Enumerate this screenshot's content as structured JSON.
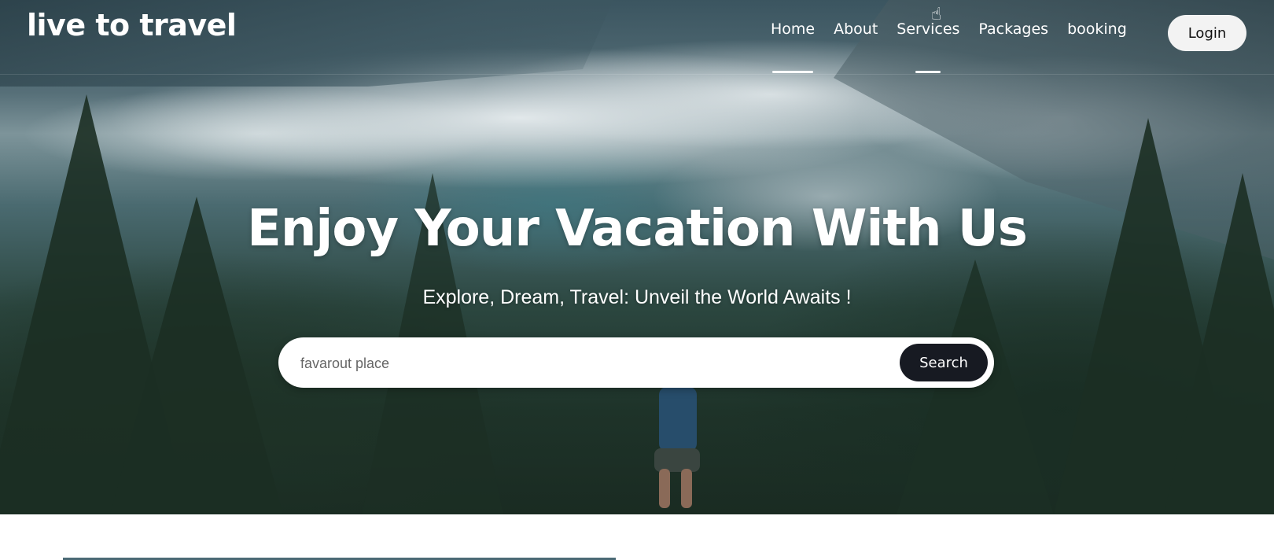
{
  "brand": {
    "logo_text": "live to travel"
  },
  "nav": {
    "items": [
      {
        "label": "Home"
      },
      {
        "label": "About"
      },
      {
        "label": "Services"
      },
      {
        "label": "Packages"
      },
      {
        "label": "booking"
      }
    ],
    "active_item": "Home",
    "hovered_item": "Services",
    "login_label": "Login"
  },
  "hero": {
    "headline": "Enjoy Your Vacation With Us",
    "subheadline": "Explore, Dream, Travel: Unveil the World Awaits !"
  },
  "search": {
    "placeholder": "favarout place",
    "value": "",
    "button_label": "Search"
  },
  "colors": {
    "accent_dark": "#171a22",
    "nav_text": "#ffffff",
    "login_bg": "#f3f3f3",
    "section_bar": "#4c6a76"
  },
  "icons": {
    "cursor": "hand-pointer-icon"
  }
}
